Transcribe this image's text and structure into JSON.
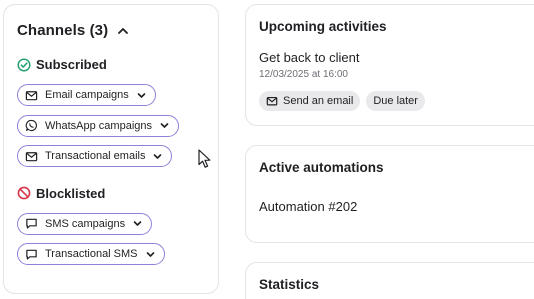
{
  "channels": {
    "title": "Channels (3)",
    "subscribed": {
      "label": "Subscribed",
      "items": [
        {
          "label": "Email campaigns",
          "icon": "envelope-icon"
        },
        {
          "label": "WhatsApp campaigns",
          "icon": "whatsapp-icon"
        },
        {
          "label": "Transactional emails",
          "icon": "envelope-icon"
        }
      ]
    },
    "blocklisted": {
      "label": "Blocklisted",
      "items": [
        {
          "label": "SMS campaigns",
          "icon": "message-icon"
        },
        {
          "label": "Transactional SMS",
          "icon": "message-icon"
        }
      ]
    }
  },
  "upcoming": {
    "title": "Upcoming activities",
    "activity_title": "Get back to client",
    "activity_date": "12/03/2025 at 16:00",
    "send_email_label": "Send an email",
    "due_later_label": "Due later"
  },
  "automations": {
    "title": "Active automations",
    "item": "Automation #202"
  },
  "statistics": {
    "title": "Statistics"
  },
  "colors": {
    "chip_border": "#8b83d9",
    "subscribed_check": "#1f9d6b",
    "blocklisted_icon": "#d6374b",
    "pill_bg": "#e9e9eb"
  }
}
